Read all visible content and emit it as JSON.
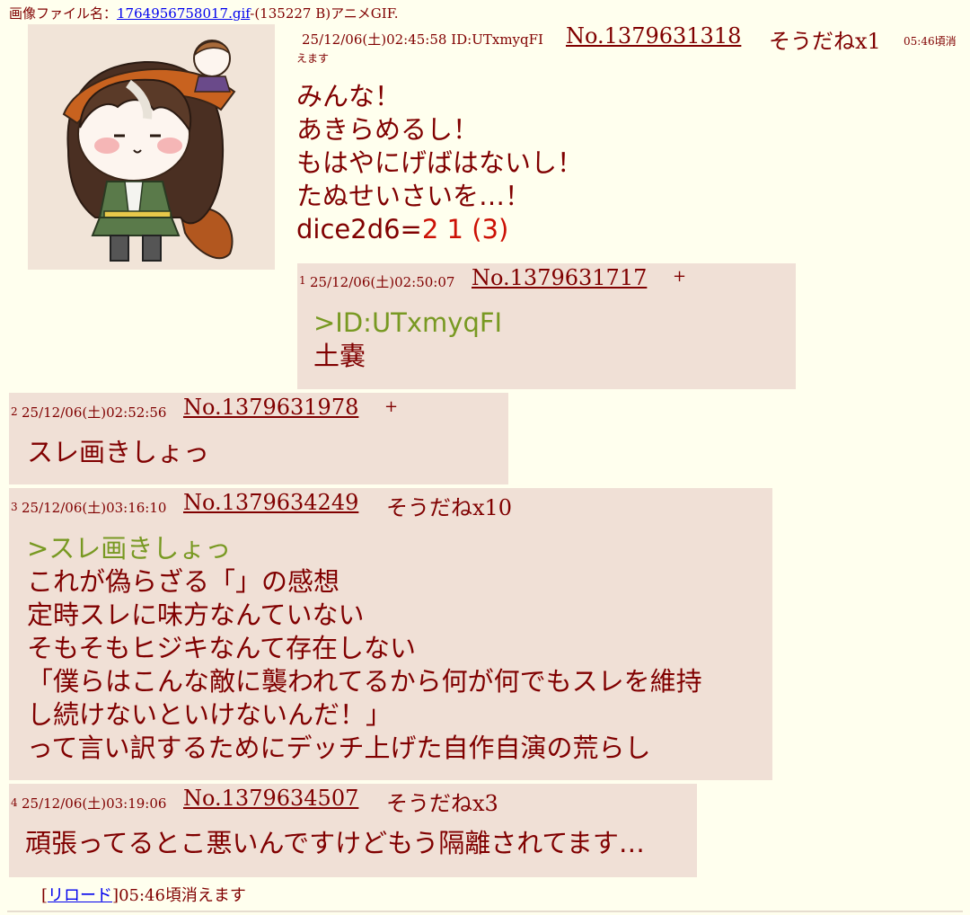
{
  "file": {
    "label": "画像ファイル名：",
    "filename": "1764956758017.gif",
    "info": "-(135227 B)アニメGIF."
  },
  "op": {
    "datetime": "25/12/06(土)02:45:58 ID:UTxmyqFI",
    "number": "No.1379631318",
    "sodane": "そうだねx1",
    "expire_a": "05:46頃消",
    "expire_b": "えます",
    "lines": [
      "みんな！",
      "あきらめるし！",
      "もはやにげばはないし！",
      "たぬせいさいを…！"
    ],
    "dice_prefix": "dice2d6=",
    "dice_result": "2 1 (3)"
  },
  "replies": [
    {
      "index": "1",
      "datetime": "25/12/06(土)02:50:07",
      "number": "No.1379631717",
      "sodane": "+",
      "quote": ">ID:UTxmyqFI",
      "lines": [
        "土嚢"
      ]
    },
    {
      "index": "2",
      "datetime": "25/12/06(土)02:52:56",
      "number": "No.1379631978",
      "sodane": "+",
      "lines": [
        "スレ画きしょっ"
      ]
    },
    {
      "index": "3",
      "datetime": "25/12/06(土)03:16:10",
      "number": "No.1379634249",
      "sodane": "そうだねx10",
      "quote": ">スレ画きしょっ",
      "lines": [
        "これが偽らざる「」の感想",
        "定時スレに味方なんていない",
        "そもそもヒジキなんて存在しない",
        "「僕らはこんな敵に襲われてるから何が何でもスレを維持",
        "し続けないといけないんだ！」",
        "って言い訳するためにデッチ上げた自作自演の荒らし"
      ]
    },
    {
      "index": "4",
      "datetime": "25/12/06(土)03:19:06",
      "number": "No.1379634507",
      "sodane": "そうだねx3",
      "lines": [
        "頑張ってるとこ悪いんですけどもう隔離されてます…"
      ]
    }
  ],
  "footer": {
    "bracket_open": "[",
    "reload": "リロード",
    "bracket_close": "]",
    "expire": "05:46頃消えます"
  },
  "colors": {
    "background": "#ffffee",
    "reply_bg": "#f0e0d6",
    "text": "#800000",
    "quote": "#789922",
    "dice": "#cc1105",
    "link": "#0000ee"
  }
}
